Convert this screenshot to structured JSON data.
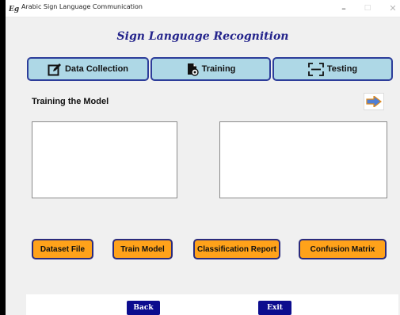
{
  "window": {
    "title": "Arabic Sign Language Communication",
    "controls": {
      "minimize": "–",
      "maximize": "□",
      "close": "✕"
    }
  },
  "heading": "Sign Language Recognition",
  "tabs": [
    {
      "label": "Data Collection",
      "icon": "edit-icon"
    },
    {
      "label": "Training",
      "icon": "file-settings-icon"
    },
    {
      "label": "Testing",
      "icon": "scan-icon"
    }
  ],
  "section": {
    "title": "Training the Model"
  },
  "actions": [
    {
      "label": "Dataset File"
    },
    {
      "label": "Train Model"
    },
    {
      "label": "Classification Report"
    },
    {
      "label": "Confusion Matrix"
    }
  ],
  "footer": {
    "back_label": "Back",
    "exit_label": "Exit"
  },
  "colors": {
    "heading": "#24248c",
    "tab_fill": "#aed8e6",
    "tab_border": "#2d3d9a",
    "action_fill": "#ffa21a",
    "nav_fill": "#0c0c8e",
    "arrow_fill": "#4f7fd6"
  }
}
